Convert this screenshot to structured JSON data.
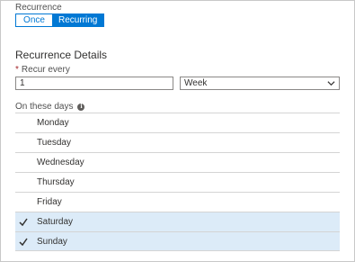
{
  "recurrence": {
    "label": "Recurrence",
    "options": [
      "Once",
      "Recurring"
    ],
    "selected": "Recurring"
  },
  "details": {
    "title": "Recurrence Details",
    "recur_every_label": "Recur every",
    "required_marker": "*",
    "interval_value": "1",
    "unit_value": "Week"
  },
  "days": {
    "label": "On these days",
    "items": [
      {
        "label": "Monday",
        "checked": false
      },
      {
        "label": "Tuesday",
        "checked": false
      },
      {
        "label": "Wednesday",
        "checked": false
      },
      {
        "label": "Thursday",
        "checked": false
      },
      {
        "label": "Friday",
        "checked": false
      },
      {
        "label": "Saturday",
        "checked": true
      },
      {
        "label": "Sunday",
        "checked": true
      }
    ]
  },
  "colors": {
    "accent": "#0078d4",
    "selected_row": "#dcebf8",
    "required": "#a4262c"
  },
  "icons": {
    "info": "info-icon",
    "dropdown": "chevron-down-icon",
    "check": "checkmark-icon"
  }
}
